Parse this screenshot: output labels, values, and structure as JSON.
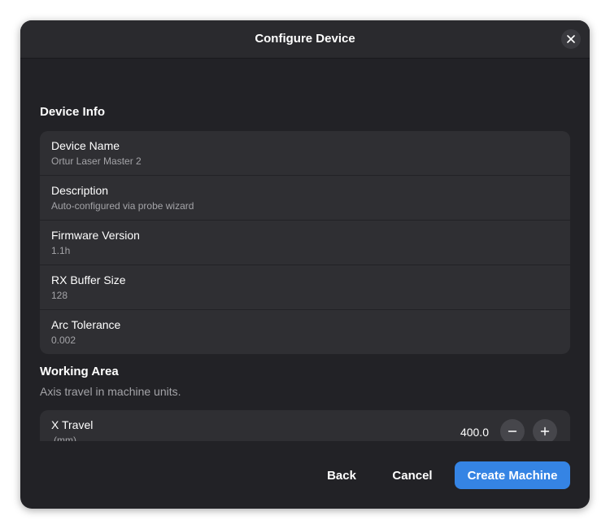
{
  "dialog": {
    "title": "Configure Device",
    "close_icon": "close-icon"
  },
  "device_info": {
    "heading": "Device Info",
    "rows": [
      {
        "title": "Device Name",
        "value": "Ortur Laser Master 2"
      },
      {
        "title": "Description",
        "value": "Auto-configured via probe wizard"
      },
      {
        "title": "Firmware Version",
        "value": "1.1h"
      },
      {
        "title": "RX Buffer Size",
        "value": "128"
      },
      {
        "title": "Arc Tolerance",
        "value": "0.002"
      }
    ]
  },
  "working_area": {
    "heading": "Working Area",
    "description": "Axis travel in machine units.",
    "rows": [
      {
        "title": "X Travel",
        "unit": "(mm)",
        "value": "400.0",
        "decrement_icon": "minus-icon",
        "increment_icon": "plus-icon"
      }
    ]
  },
  "footer": {
    "back_label": "Back",
    "cancel_label": "Cancel",
    "create_label": "Create Machine"
  },
  "colors": {
    "accent": "#3584e4",
    "dialog_bg": "#222226",
    "card_bg": "#2f2f33"
  }
}
